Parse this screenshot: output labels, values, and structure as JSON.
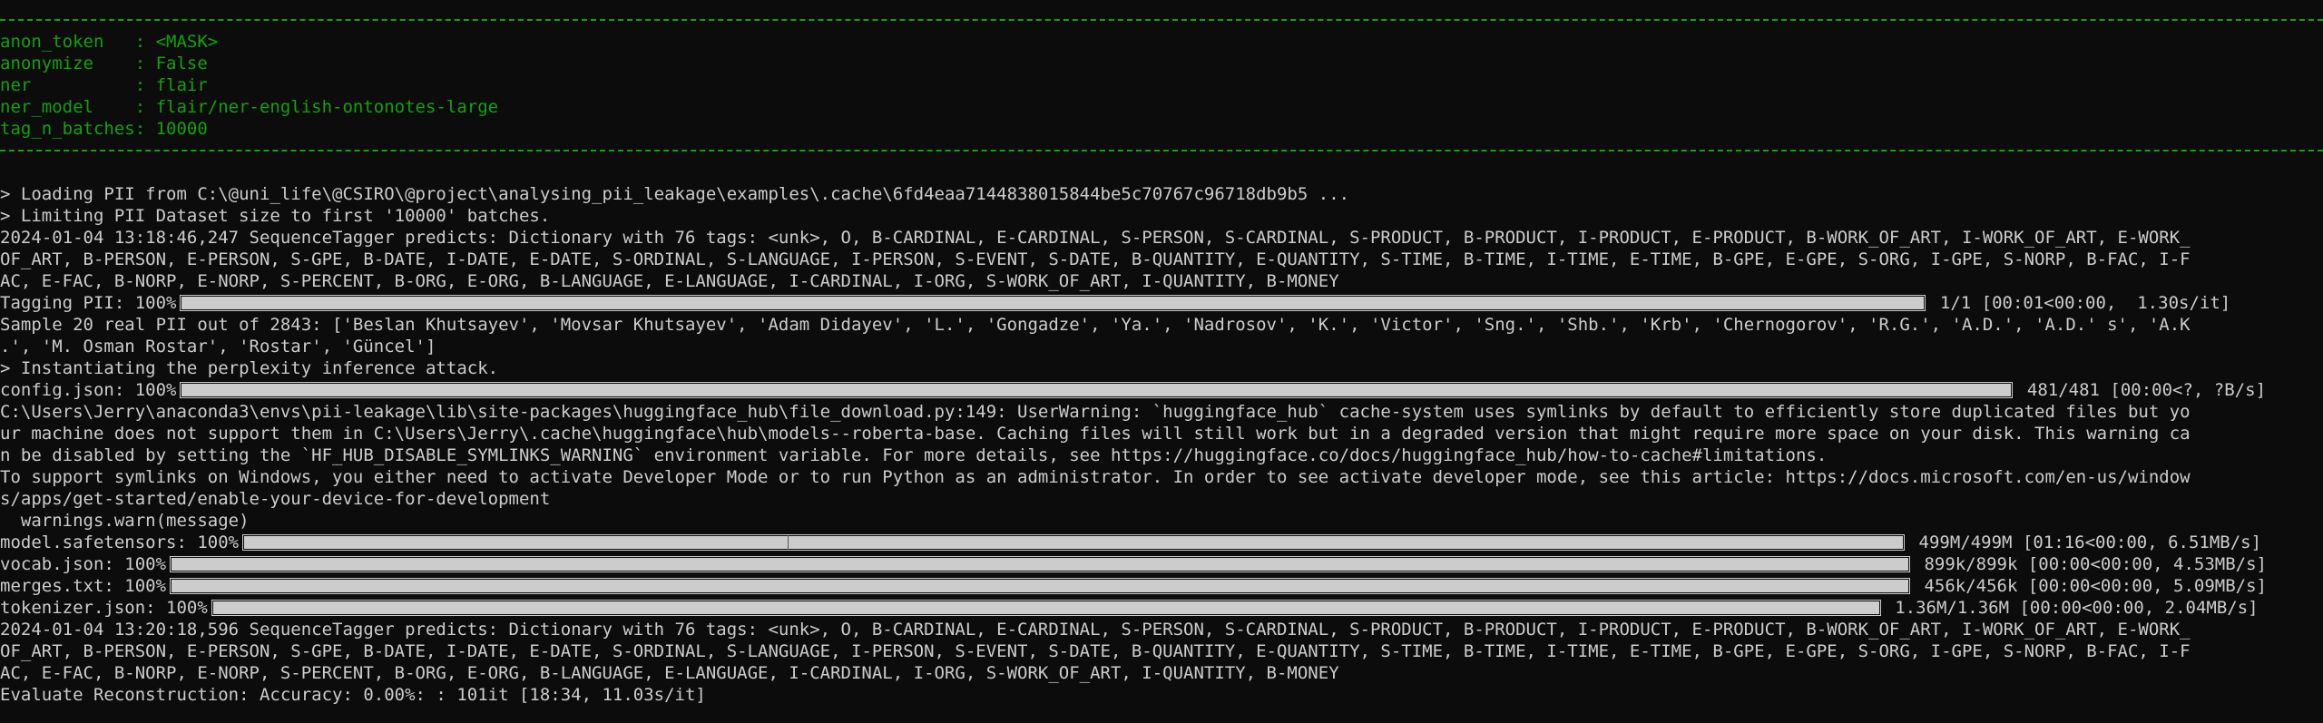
{
  "colors": {
    "background": "#0c0c0c",
    "text": "#cccccc",
    "green": "#13a10e"
  },
  "config": {
    "lines": [
      "anon_token   : <MASK>",
      "anonymize    : False",
      "ner          : flair",
      "ner_model    : flair/ner-english-ontonotes-large",
      "tag_n_batches: 10000"
    ]
  },
  "log": {
    "loading": "> Loading PII from C:\\@uni_life\\@CSIRO\\@project\\analysing_pii_leakage\\examples\\.cache\\6fd4eaa7144838015844be5c70767c96718db9b5 ...",
    "limiting": "> Limiting PII Dataset size to first '10000' batches.",
    "tagger1": [
      "2024-01-04 13:18:46,247 SequenceTagger predicts: Dictionary with 76 tags: <unk>, O, B-CARDINAL, E-CARDINAL, S-PERSON, S-CARDINAL, S-PRODUCT, B-PRODUCT, I-PRODUCT, E-PRODUCT, B-WORK_OF_ART, I-WORK_OF_ART, E-WORK_",
      "OF_ART, B-PERSON, E-PERSON, S-GPE, B-DATE, I-DATE, E-DATE, S-ORDINAL, S-LANGUAGE, I-PERSON, S-EVENT, S-DATE, B-QUANTITY, E-QUANTITY, S-TIME, B-TIME, I-TIME, E-TIME, B-GPE, E-GPE, S-ORG, I-GPE, S-NORP, B-FAC, I-F",
      "AC, E-FAC, B-NORP, E-NORP, S-PERCENT, B-ORG, E-ORG, B-LANGUAGE, E-LANGUAGE, I-CARDINAL, I-ORG, S-WORK_OF_ART, I-QUANTITY, B-MONEY"
    ],
    "tagging_bar": {
      "label": "Tagging PII: 100%",
      "progress": 1.0,
      "stats": " 1/1 [00:01<00:00,  1.30s/it]"
    },
    "sample": [
      "Sample 20 real PII out of 2843: ['Beslan Khutsayev', 'Movsar Khutsayev', 'Adam Didayev', 'L.', 'Gongadze', 'Ya.', 'Nadrosov', 'K.', 'Victor', 'Sng.', 'Shb.', 'Krb', 'Chernogorov', 'R.G.', 'A.D.', 'A.D.' s', 'A.K",
      ".', 'M. Osman Rostar', 'Rostar', 'Güncel']"
    ],
    "instantiating": "> Instantiating the perplexity inference attack.",
    "config_bar": {
      "label": "config.json: 100%",
      "progress": 1.0,
      "stats": " 481/481 [00:00<?, ?B/s]"
    },
    "warning": [
      "C:\\Users\\Jerry\\anaconda3\\envs\\pii-leakage\\lib\\site-packages\\huggingface_hub\\file_download.py:149: UserWarning: `huggingface_hub` cache-system uses symlinks by default to efficiently store duplicated files but yo",
      "ur machine does not support them in C:\\Users\\Jerry\\.cache\\huggingface\\hub\\models--roberta-base. Caching files will still work but in a degraded version that might require more space on your disk. This warning ca",
      "n be disabled by setting the `HF_HUB_DISABLE_SYMLINKS_WARNING` environment variable. For more details, see https://huggingface.co/docs/huggingface_hub/how-to-cache#limitations.",
      "To support symlinks on Windows, you either need to activate Developer Mode or to run Python as an administrator. In order to see activate developer mode, see this article: https://docs.microsoft.com/en-us/window",
      "s/apps/get-started/enable-your-device-for-development",
      "  warnings.warn(message)"
    ],
    "model_bar": {
      "label": "model.safetensors: 100%",
      "progress": 1.0,
      "stats": " 499M/499M [01:16<00:00, 6.51MB/s]"
    },
    "vocab_bar": {
      "label": "vocab.json: 100%",
      "progress": 1.0,
      "stats": " 899k/899k [00:00<00:00, 4.53MB/s]"
    },
    "merges_bar": {
      "label": "merges.txt: 100%",
      "progress": 1.0,
      "stats": " 456k/456k [00:00<00:00, 5.09MB/s]"
    },
    "tokenizer_bar": {
      "label": "tokenizer.json: 100%",
      "progress": 1.0,
      "stats": " 1.36M/1.36M [00:00<00:00, 2.04MB/s]"
    },
    "tagger2": [
      "2024-01-04 13:20:18,596 SequenceTagger predicts: Dictionary with 76 tags: <unk>, O, B-CARDINAL, E-CARDINAL, S-PERSON, S-CARDINAL, S-PRODUCT, B-PRODUCT, I-PRODUCT, E-PRODUCT, B-WORK_OF_ART, I-WORK_OF_ART, E-WORK_",
      "OF_ART, B-PERSON, E-PERSON, S-GPE, B-DATE, I-DATE, E-DATE, S-ORDINAL, S-LANGUAGE, I-PERSON, S-EVENT, S-DATE, B-QUANTITY, E-QUANTITY, S-TIME, B-TIME, I-TIME, E-TIME, B-GPE, E-GPE, S-ORG, I-GPE, S-NORP, B-FAC, I-F",
      "AC, E-FAC, B-NORP, E-NORP, S-PERCENT, B-ORG, E-ORG, B-LANGUAGE, E-LANGUAGE, I-CARDINAL, I-ORG, S-WORK_OF_ART, I-QUANTITY, B-MONEY"
    ],
    "evaluate": "Evaluate Reconstruction: Accuracy: 0.00%: : 101it [18:34, 11.03s/it]"
  }
}
